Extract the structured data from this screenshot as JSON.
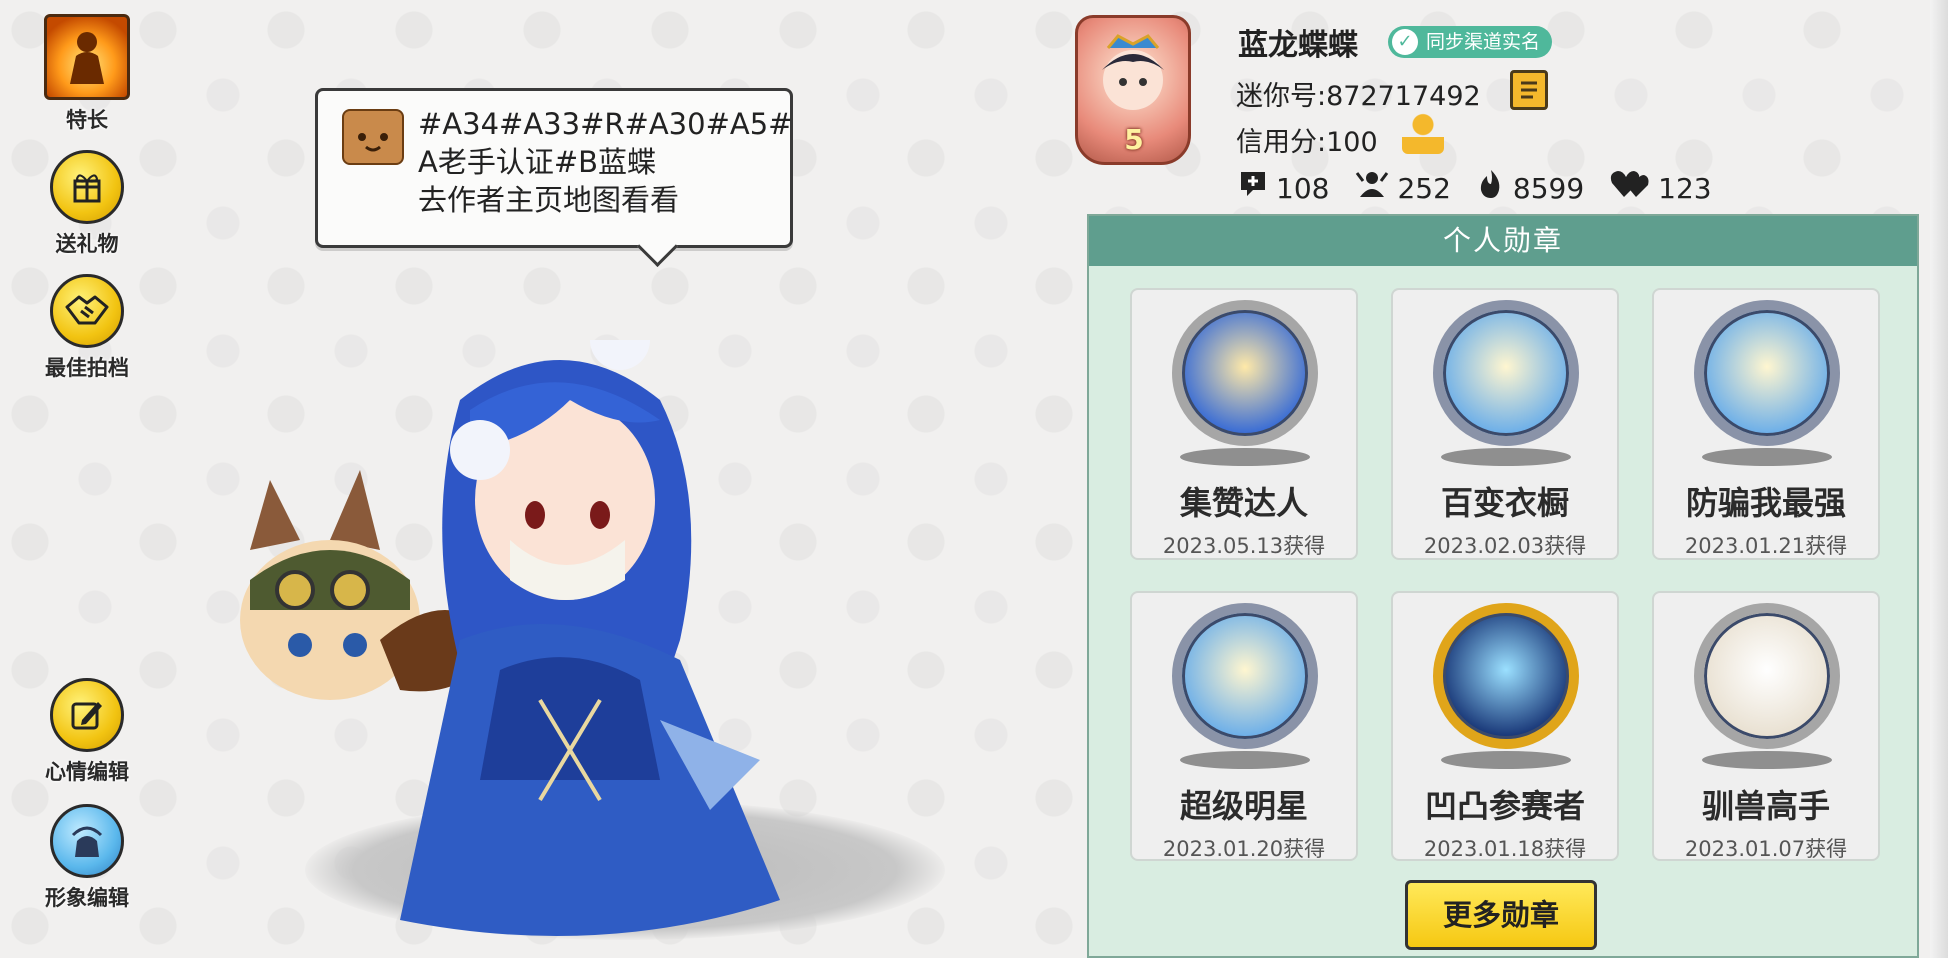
{
  "left_menu": [
    {
      "label": "特长",
      "icon": "fire-figure-icon"
    },
    {
      "label": "送礼物",
      "icon": "gift-icon"
    },
    {
      "label": "最佳拍档",
      "icon": "handshake-icon"
    },
    {
      "label": "心情编辑",
      "icon": "edit-icon"
    },
    {
      "label": "形象编辑",
      "icon": "avatar-edit-icon"
    }
  ],
  "bubble": {
    "lines": [
      "#A34#A33#R#A30#A5#",
      "A老手认证#B蓝蝶",
      "去作者主页地图看看"
    ]
  },
  "profile": {
    "level": "5",
    "name": "蓝龙蝶蝶",
    "sync_badge": "同步渠道实名",
    "id_text": "迷你号:872717492",
    "credit_text": "信用分:100",
    "stats": [
      {
        "icon": "add-friend-icon",
        "value": "108"
      },
      {
        "icon": "fans-icon",
        "value": "252"
      },
      {
        "icon": "fire-icon",
        "value": "8599"
      },
      {
        "icon": "heart-icon",
        "value": "123"
      }
    ]
  },
  "medals": {
    "title": "个人勋章",
    "items": [
      {
        "name": "集赞达人",
        "date": "2023.05.13获得",
        "style": "silver"
      },
      {
        "name": "百变衣橱",
        "date": "2023.02.03获得",
        "style": "normal"
      },
      {
        "name": "防骗我最强",
        "date": "2023.01.21获得",
        "style": "normal"
      },
      {
        "name": "超级明星",
        "date": "2023.01.20获得",
        "style": "normal"
      },
      {
        "name": "凹凸参赛者",
        "date": "2023.01.18获得",
        "style": "gold"
      },
      {
        "name": "驯兽高手",
        "date": "2023.01.07获得",
        "style": "white"
      }
    ],
    "more_button": "更多勋章"
  }
}
